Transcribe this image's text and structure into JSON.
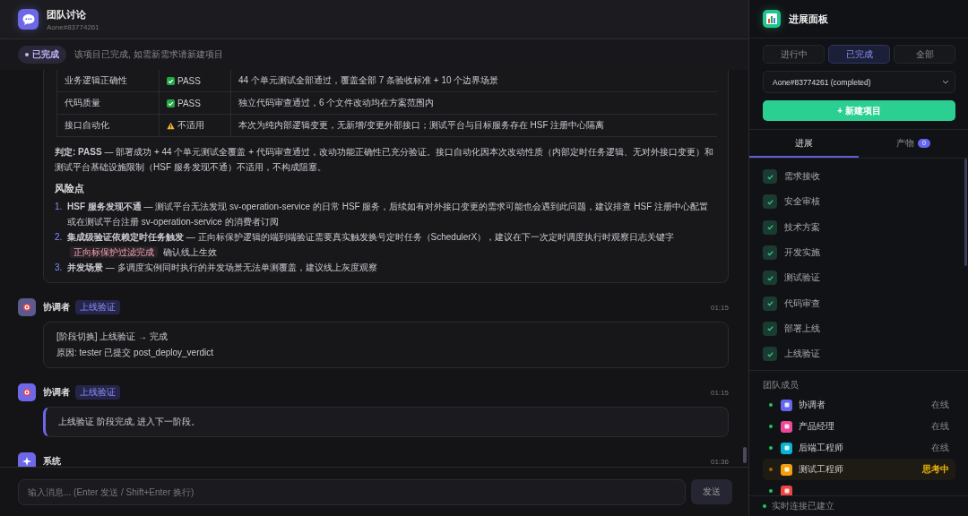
{
  "header": {
    "title": "团队讨论",
    "subtitle": "Aone#83774261"
  },
  "status": {
    "badge": "已完成",
    "note": "该项目已完成, 如需新需求请新建项目"
  },
  "review_table": [
    {
      "item": "业务逻辑正确性",
      "result": "PASS",
      "kind": "pass",
      "detail": "44 个单元测试全部通过，覆盖全部 7 条验收标准 + 10 个边界场景"
    },
    {
      "item": "代码质量",
      "result": "PASS",
      "kind": "pass",
      "detail": "独立代码审查通过，6 个文件改动均在方案范围内"
    },
    {
      "item": "接口自动化",
      "result": "不适用",
      "kind": "warn",
      "detail": "本次为纯内部逻辑变更，无新增/变更外部接口；测试平台与目标服务存在 HSF 注册中心隔离"
    }
  ],
  "verdict": "**判定: PASS** — 部署成功 + 44 个单元测试全覆盖 + 代码审查通过，改动功能正确性已充分验证。接口自动化因本次改动性质（内部定时任务逻辑、无对外接口变更）和测试平台基础设施限制（HSF 服务发现不通）不适用，不构成阻塞。",
  "risks_heading": "风险点",
  "risks": [
    {
      "number": "1.",
      "text": "**HSF 服务发现不通** — 测试平台无法发现 sv-operation-service 的日常 HSF 服务，后续如有对外接口变更的需求可能也会遇到此问题，建议排查 HSF 注册中心配置或在测试平台注册 sv-operation-service 的消费者订阅"
    },
    {
      "number": "2.",
      "text": "**集成级验证依赖定时任务触发** — 正向标保护逻辑的端到端验证需要真实触发换号定时任务（SchedulerX），建议在下一次定时调度执行时观察日志关键字",
      "code": "正向标保护过滤完成",
      "text_after": "确认线上生效"
    },
    {
      "number": "3.",
      "text": "**并发场景** — 多调度实例同时执行的并发场景无法单测覆盖，建议线上灰度观察"
    }
  ],
  "messages": [
    {
      "sender": "协调者",
      "tag": "上线验证",
      "time": "01:15",
      "kind": "plain",
      "lines": [
        "[阶段切换] 上线验证 → 完成",
        "原因: tester 已提交 post_deploy_verdict"
      ]
    },
    {
      "sender": "协调者",
      "tag": "上线验证",
      "time": "01:15",
      "kind": "accent",
      "lines": [
        "上线验证 阶段完成, 进入下一阶段。"
      ]
    },
    {
      "sender": "系统",
      "time": "01:36",
      "kind": "system"
    }
  ],
  "composer": {
    "placeholder": "输入消息... (Enter 发送 / Shift+Enter 换行)",
    "send": "发送"
  },
  "panel": {
    "title": "进展面板",
    "filters": [
      {
        "label": "进行中",
        "selected": false
      },
      {
        "label": "已完成",
        "selected": true
      },
      {
        "label": "全部",
        "selected": false
      }
    ],
    "project": "Aone#83774261 (completed)",
    "new_button": "+ 新建项目",
    "tabs": [
      {
        "label": "进展",
        "selected": true
      },
      {
        "label": "产物",
        "selected": false,
        "badge": "0"
      }
    ],
    "stages": [
      {
        "label": "需求接收",
        "checked": true
      },
      {
        "label": "安全审核",
        "checked": true
      },
      {
        "label": "技术方案",
        "checked": true
      },
      {
        "label": "开发实施",
        "checked": true
      },
      {
        "label": "测试验证",
        "checked": true
      },
      {
        "label": "代码审查",
        "checked": true
      },
      {
        "label": "部署上线",
        "checked": true
      },
      {
        "label": "上线验证",
        "checked": true
      }
    ],
    "team_heading": "团队成员",
    "members": [
      {
        "name": "协调者",
        "status": "在线",
        "busy": false,
        "color": "#6366f1"
      },
      {
        "name": "产品经理",
        "status": "在线",
        "busy": false,
        "color": "#ec4899"
      },
      {
        "name": "后端工程师",
        "status": "在线",
        "busy": false,
        "color": "#06b6d4"
      },
      {
        "name": "测试工程师",
        "status": "思考中",
        "busy": true,
        "color": "#f59e0b"
      },
      {
        "busy": false,
        "color": "#ef4444"
      }
    ],
    "connection": "实时连接已建立"
  }
}
